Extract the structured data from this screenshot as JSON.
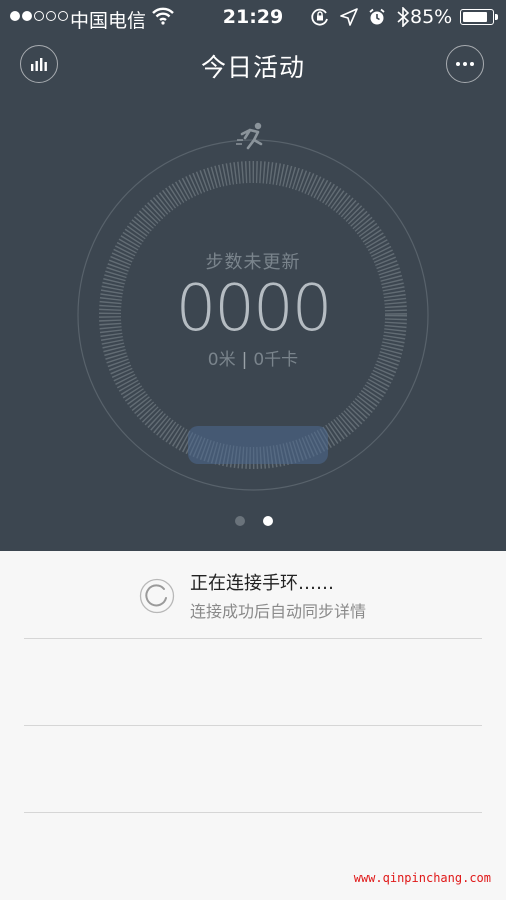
{
  "status_bar": {
    "carrier": "中国电信",
    "time": "21:29",
    "battery": "85%"
  },
  "header": {
    "title": "今日活动"
  },
  "activity": {
    "status": "步数未更新",
    "steps": "0000",
    "distance": "0米",
    "separator": "|",
    "calories": "0千卡"
  },
  "connection": {
    "title": "正在连接手环……",
    "subtitle": "连接成功后自动同步详情"
  },
  "watermark": "www.qinpinchang.com"
}
